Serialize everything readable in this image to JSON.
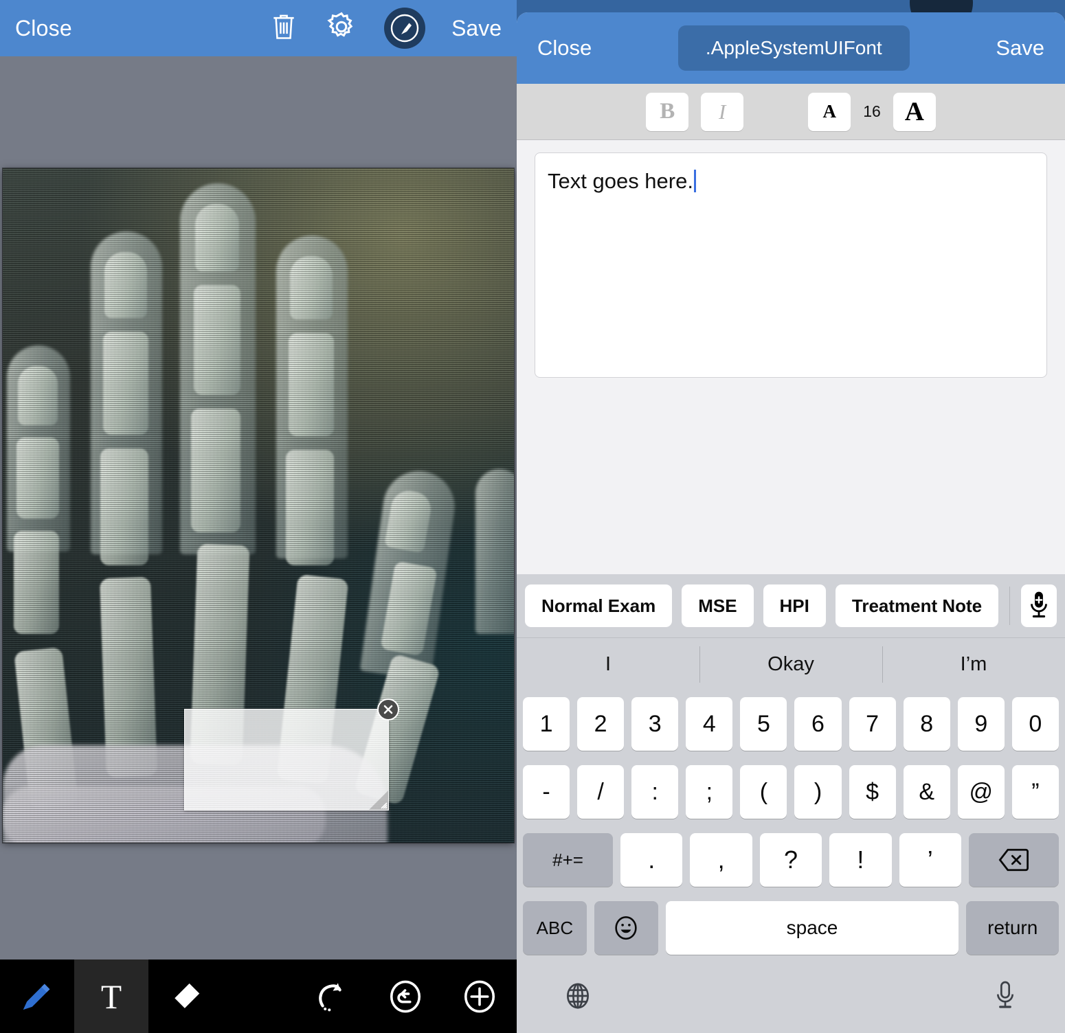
{
  "left_panel": {
    "header": {
      "close_label": "Close",
      "save_label": "Save",
      "trash_icon": "trash-icon",
      "gear_icon": "gear-icon",
      "brush_icon": "brush-disc-icon"
    },
    "canvas": {
      "image_description": "hand-xray-photo",
      "textbox": {
        "value": "",
        "close_icon": "close-circle-icon",
        "resize_icon": "resize-handle-icon"
      }
    },
    "toolbar": {
      "items": [
        {
          "name": "pen-tool",
          "icon": "pen-icon",
          "active": false
        },
        {
          "name": "text-tool",
          "icon": "text-t-icon",
          "active": true
        },
        {
          "name": "eraser-tool",
          "icon": "eraser-icon",
          "active": false
        },
        {
          "name": "redo-tool",
          "icon": "redo-arrow-icon",
          "active": false
        },
        {
          "name": "undo-tool",
          "icon": "undo-circle-icon",
          "active": false
        },
        {
          "name": "add-tool",
          "icon": "plus-circle-icon",
          "active": false
        }
      ]
    }
  },
  "right_panel": {
    "header": {
      "close_label": "Close",
      "font_name": ".AppleSystemUIFont",
      "save_label": "Save"
    },
    "format_bar": {
      "bold_label": "B",
      "italic_label": "I",
      "decrease_size_label": "A",
      "font_size": "16",
      "increase_size_label": "A"
    },
    "note": {
      "value": "Text goes here.",
      "placeholder": ""
    },
    "macros": {
      "buttons": [
        "Normal Exam",
        "MSE",
        "HPI",
        "Treatment Note"
      ],
      "dictate_icon": "mic-plus-icon"
    },
    "predictive": {
      "suggestions": [
        "I",
        "Okay",
        "I’m"
      ]
    },
    "keyboard": {
      "row1": [
        "1",
        "2",
        "3",
        "4",
        "5",
        "6",
        "7",
        "8",
        "9",
        "0"
      ],
      "row2": [
        "-",
        "/",
        ":",
        ";",
        "(",
        ")",
        "$",
        "&",
        "@",
        "”"
      ],
      "row3": {
        "symbols_label": "#+=",
        "keys": [
          ".",
          ",",
          "?",
          "!",
          "’"
        ],
        "backspace_icon": "backspace-icon"
      },
      "row4": {
        "abc_label": "ABC",
        "emoji_icon": "emoji-smiley-icon",
        "space_label": "space",
        "return_label": "return"
      },
      "footer": {
        "globe_icon": "globe-icon",
        "mic_icon": "mic-icon"
      }
    }
  },
  "colors": {
    "header_blue": "#4d87ce",
    "sheet_backdrop_blue": "#35659f",
    "chip_blue": "#3b6da8",
    "canvas_gray": "#767b87",
    "toolbar_black": "#000000",
    "pen_blue": "#2f6fd0",
    "keyboard_gray": "#d0d2d7",
    "caret_blue": "#3a6fe0"
  }
}
